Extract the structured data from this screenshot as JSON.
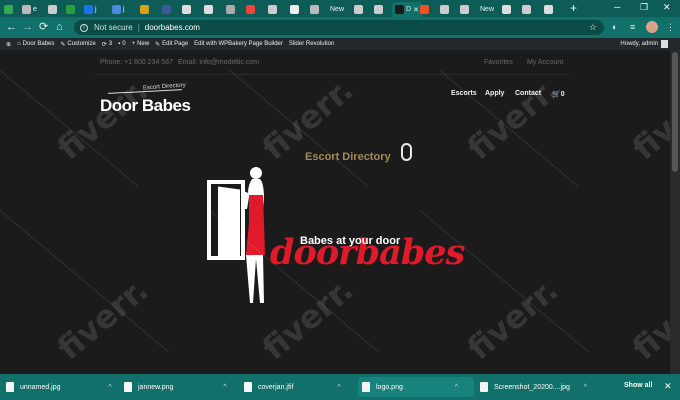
{
  "browser": {
    "tabs": [
      {
        "label": "",
        "left": 0
      },
      {
        "label": "",
        "left": 0
      },
      {
        "label": "",
        "left": 0
      },
      {
        "label": "",
        "left": 0
      },
      {
        "label": "",
        "left": 0
      }
    ],
    "tab_labels": [
      "e",
      "j",
      "j",
      "New",
      "New",
      "D"
    ],
    "active_tab_label": "D",
    "nav": {
      "back": "←",
      "forward": "→",
      "reload": "⟳",
      "home": "⌂"
    },
    "address": {
      "security": "Not secure",
      "separator": "|",
      "url": "doorbabes.com"
    }
  },
  "wp_admin_bar": {
    "site_name": "Door Babes",
    "customize": "Customize",
    "updates": "3",
    "comments": "0",
    "new": "New",
    "edit_page": "Edit Page",
    "wpbakery": "Edit with WPBakery Page Builder",
    "slider": "Slider Revolution",
    "howdy": "Howdy, admin"
  },
  "site": {
    "phone": "Phone: +1 800 234 567",
    "email": "Email: info@modeltic.com",
    "favorites": "Favorites",
    "account": "My Account",
    "logo_main": "Door Babes",
    "logo_sub": "Escort Directory",
    "menu": [
      "Escorts",
      "Apply",
      "Contact"
    ],
    "cart_count": "0",
    "tagline": "Escort Directory",
    "wordmark_a": "door",
    "wordmark_b": "babes",
    "slogan": "Babes at your door",
    "watermark": "fiverr."
  },
  "downloads": {
    "items": [
      "unnamed.jpg",
      "jannew.png",
      "coverjan.jfif",
      "logo.png",
      "Screenshot_20200....jpg"
    ],
    "show_all": "Show all"
  },
  "colors": {
    "teal": "#11706a",
    "red": "#e01a2a",
    "gold": "#a08a5b"
  }
}
